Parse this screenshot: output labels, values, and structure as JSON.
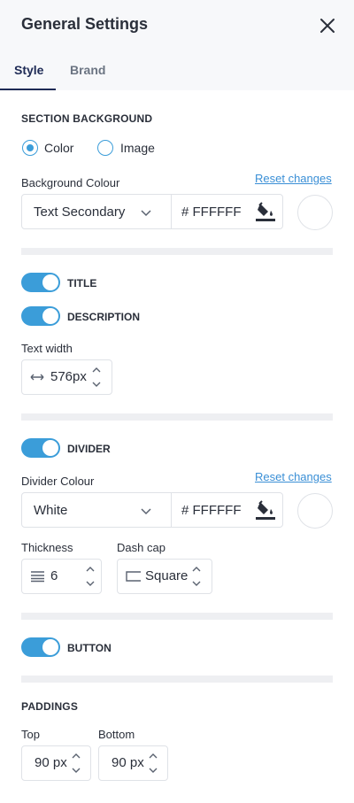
{
  "header": {
    "title": "General Settings",
    "tabs": [
      {
        "label": "Style",
        "active": true
      },
      {
        "label": "Brand",
        "active": false
      }
    ]
  },
  "section_background": {
    "label": "SECTION BACKGROUND",
    "options": [
      {
        "label": "Color",
        "checked": true
      },
      {
        "label": "Image",
        "checked": false
      }
    ],
    "colour_label": "Background Colour",
    "reset_label": "Reset changes",
    "select_value": "Text Secondary",
    "hex_value": "# FFFFFF",
    "swatch_color": "#FFFFFF"
  },
  "title_toggle": {
    "label": "TITLE",
    "on": true
  },
  "description_toggle": {
    "label": "DESCRIPTION",
    "on": true
  },
  "text_width": {
    "label": "Text width",
    "value": "576px"
  },
  "divider_toggle": {
    "label": "DIVIDER",
    "on": true
  },
  "divider_colour": {
    "label": "Divider  Colour",
    "reset_label": "Reset changes",
    "select_value": "White",
    "hex_value": "# FFFFFF",
    "swatch_color": "#FFFFFF"
  },
  "thickness": {
    "label": "Thickness",
    "value": "6"
  },
  "dash_cap": {
    "label": "Dash cap",
    "value": "Square"
  },
  "button_toggle": {
    "label": "BUTTON",
    "on": true
  },
  "paddings": {
    "label": "PADDINGS",
    "top_label": "Top",
    "top_value": "90 px",
    "bottom_label": "Bottom",
    "bottom_value": "90 px"
  },
  "colors": {
    "accent": "#3b9dd9",
    "link": "#3a8fd6",
    "tab_active": "#1e2a55"
  }
}
